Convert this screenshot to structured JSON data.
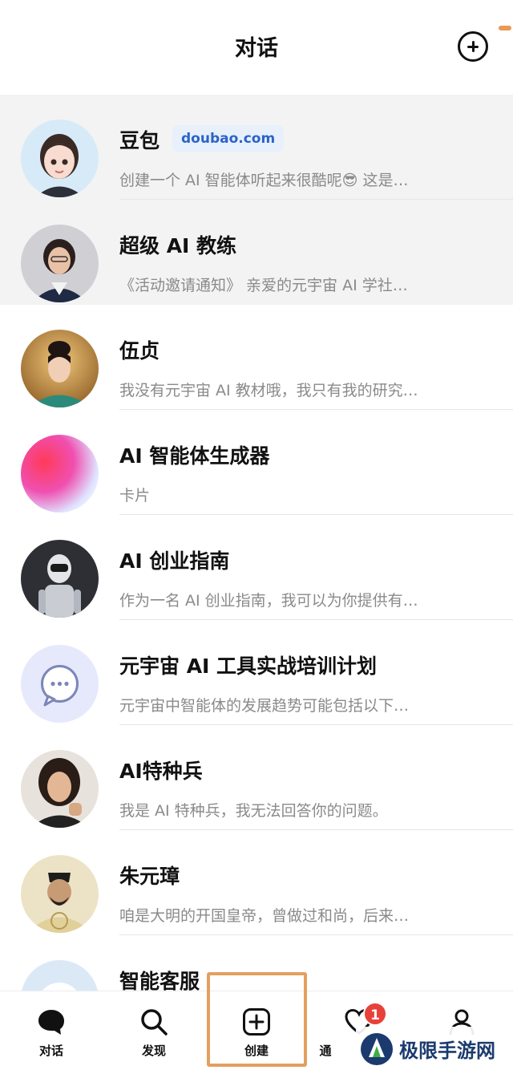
{
  "header": {
    "title": "对话"
  },
  "conversations": [
    {
      "name": "豆包",
      "tag": "doubao.com",
      "preview": "创建一个 AI 智能体听起来很酷呢😎 这是…"
    },
    {
      "name": "超级 AI 教练",
      "preview": "《活动邀请通知》 亲爱的元宇宙 AI 学社…"
    },
    {
      "name": "伍贞",
      "preview": "我没有元宇宙 AI 教材哦，我只有我的研究…"
    },
    {
      "name": "AI 智能体生成器",
      "preview": "卡片"
    },
    {
      "name": "AI 创业指南",
      "preview": "作为一名 AI 创业指南，我可以为你提供有…"
    },
    {
      "name": "元宇宙 AI 工具实战培训计划",
      "preview": "元宇宙中智能体的发展趋势可能包括以下…"
    },
    {
      "name": "AI特种兵",
      "preview": "我是 AI 特种兵，我无法回答你的问题。"
    },
    {
      "name": "朱元璋",
      "preview": "咱是大明的开国皇帝，曾做过和尚，后来…"
    },
    {
      "name": "智能客服",
      "preview": ""
    }
  ],
  "tabbar": {
    "tabs": [
      {
        "label": "对话",
        "icon": "chat-bubble-icon"
      },
      {
        "label": "发现",
        "icon": "search-icon"
      },
      {
        "label": "创建",
        "icon": "plus-square-icon"
      },
      {
        "label": "通",
        "icon": "heart-icon"
      },
      {
        "label": "",
        "icon": "person-icon"
      }
    ],
    "badge_count": "1"
  },
  "watermark": {
    "text": "极限手游网"
  },
  "colors": {
    "accent_blue": "#2b63c9",
    "badge_red": "#e8413a",
    "highlight_orange": "#e2a05f"
  }
}
